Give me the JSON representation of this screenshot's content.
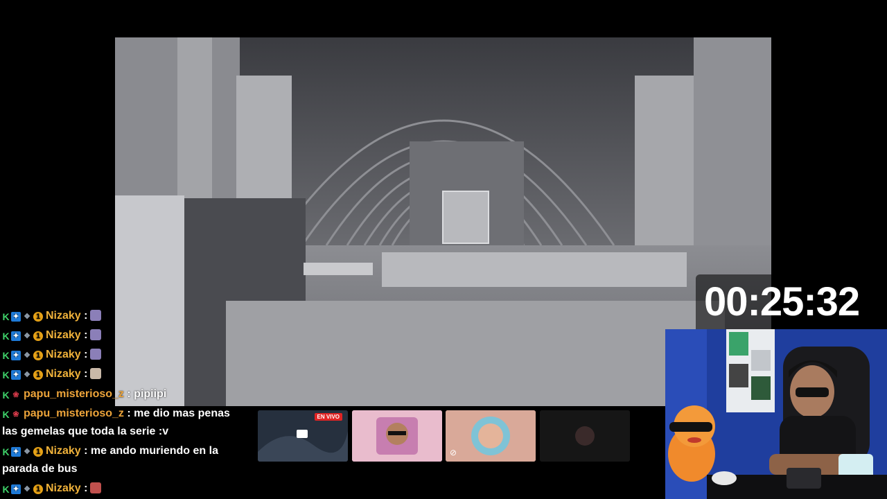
{
  "stream": {
    "timer": "00:25:32"
  },
  "chat": {
    "messages": [
      {
        "user": "Nizaky",
        "sep": " :",
        "text": "",
        "emote_color": "#8b7fb8"
      },
      {
        "user": "Nizaky",
        "sep": " :",
        "text": "",
        "emote_color": "#8b7fb8"
      },
      {
        "user": "Nizaky",
        "sep": " :",
        "text": "",
        "emote_color": "#8b7fb8"
      },
      {
        "user": "Nizaky",
        "sep": " :",
        "text": "",
        "emote_color": "#c9b9a8"
      },
      {
        "user": "papu_misterioso_z",
        "sep": " :",
        "text": " pipiipi"
      },
      {
        "user": "papu_misterioso_z",
        "sep": " :",
        "text": " me dio mas penas las gemelas que toda la serie :v"
      },
      {
        "user": "Nizaky",
        "sep": " :",
        "text": " me ando muriendo en la parada de bus"
      },
      {
        "user": "Nizaky",
        "sep": " :",
        "text": "",
        "emote_color": "#c0504d"
      }
    ]
  },
  "recommendations": {
    "live_badge": "EN VIVO"
  },
  "colors": {
    "username_nizaky": "#f0b23a",
    "username_papu": "#eda43a",
    "webcam_wall": "#1f3e9e",
    "live_badge": "#e02424"
  }
}
